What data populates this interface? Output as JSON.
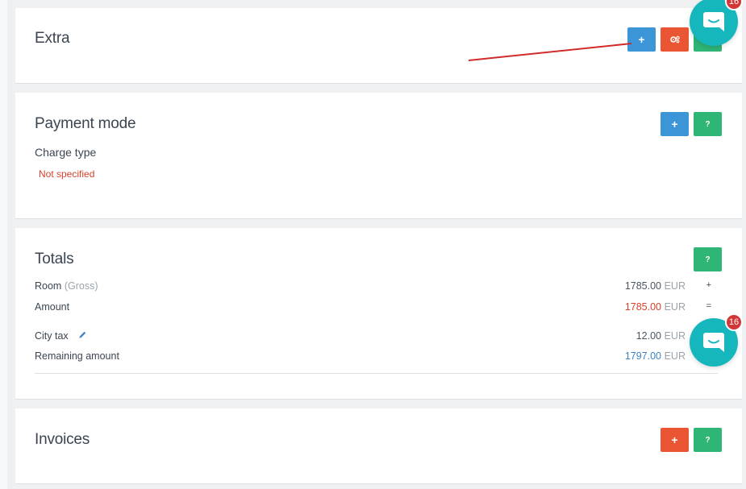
{
  "extra": {
    "title": "Extra",
    "add_button_label": "+",
    "settings_icon": "gears-icon"
  },
  "payment_mode": {
    "title": "Payment mode",
    "add_button_label": "+",
    "help_button_label": "?",
    "charge_type_label": "Charge type",
    "charge_type_value": "Not specified"
  },
  "totals": {
    "title": "Totals",
    "help_button_label": "?",
    "room_label": "Room",
    "room_qualifier": "(Gross)",
    "room_amount": "1785.00",
    "room_currency": "EUR",
    "room_operator": "+",
    "amount_label": "Amount",
    "amount_value": "1785.00",
    "amount_currency": "EUR",
    "amount_operator": "=",
    "city_tax_label": "City tax",
    "city_tax_amount": "12.00",
    "city_tax_currency": "EUR",
    "remaining_label": "Remaining amount",
    "remaining_amount": "1797.00",
    "remaining_currency": "EUR"
  },
  "invoices": {
    "title": "Invoices",
    "add_button_label": "+",
    "help_button_label": "?"
  },
  "chat_widget": {
    "badge_count": "16"
  },
  "colors": {
    "blue": "#3c95d6",
    "orange": "#ea5633",
    "green": "#2fb576",
    "teal": "#16b6bd",
    "red_text": "#d9412b",
    "badge_red": "#d33636"
  }
}
